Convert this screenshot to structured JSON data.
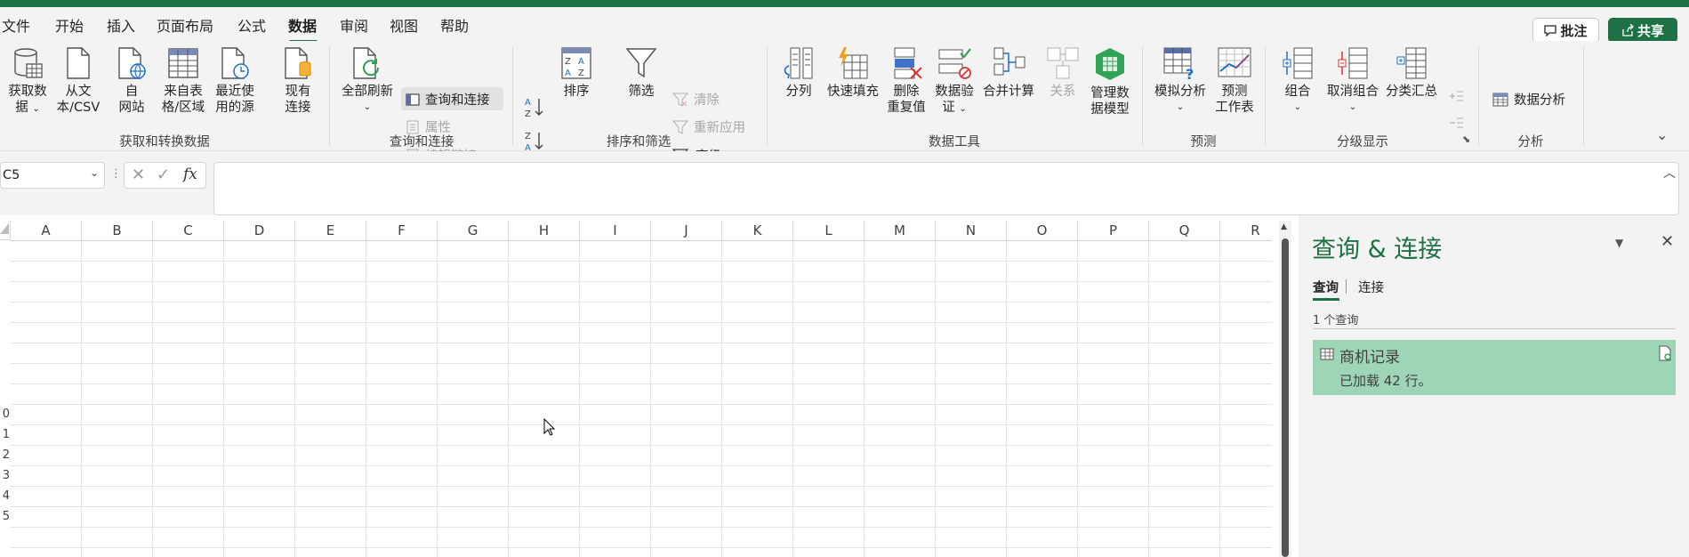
{
  "menu": {
    "items": [
      "文件",
      "开始",
      "插入",
      "页面布局",
      "公式",
      "数据",
      "审阅",
      "视图",
      "帮助"
    ],
    "active": "数据",
    "comment_label": "批注",
    "share_label": "共享"
  },
  "ribbon": {
    "get_data": {
      "line1": "获取数",
      "line2": "据"
    },
    "from_text": {
      "line1": "从文",
      "line2": "本/CSV"
    },
    "from_web": {
      "line1": "自",
      "line2": "网站"
    },
    "from_table": {
      "line1": "来自表",
      "line2": "格/区域"
    },
    "recent_sources": {
      "line1": "最近使",
      "line2": "用的源"
    },
    "existing_conn": {
      "line1": "现有",
      "line2": "连接"
    },
    "refresh_all": {
      "line1": "全部刷新"
    },
    "queries_connections": "查询和连接",
    "properties": "属性",
    "edit_links": "编辑链接",
    "sort": "排序",
    "filter": "筛选",
    "clear": "清除",
    "reapply": "重新应用",
    "advanced": "高级",
    "text_to_columns": "分列",
    "flash_fill": "快速填充",
    "remove_duplicates": {
      "line1": "删除",
      "line2": "重复值"
    },
    "data_validation": {
      "line1": "数据验",
      "line2": "证"
    },
    "consolidate": "合并计算",
    "relationships": "关系",
    "manage_model": {
      "line1": "管理数",
      "line2": "据模型"
    },
    "what_if": {
      "line1": "模拟分析"
    },
    "forecast_sheet": {
      "line1": "预测",
      "line2": "工作表"
    },
    "group": {
      "line1": "组合"
    },
    "ungroup": {
      "line1": "取消组合"
    },
    "subtotal": "分类汇总",
    "data_analysis": "数据分析",
    "groups": {
      "get_transform": "获取和转换数据",
      "queries_connections": "查询和连接",
      "sort_filter": "排序和筛选",
      "data_tools": "数据工具",
      "forecast": "预测",
      "outline": "分级显示",
      "analysis": "分析"
    }
  },
  "formula_bar": {
    "name_box": "C5",
    "fx": "fx",
    "value": ""
  },
  "grid": {
    "columns": [
      "A",
      "B",
      "C",
      "D",
      "E",
      "F",
      "G",
      "H",
      "I",
      "J",
      "K",
      "L",
      "M",
      "N",
      "O",
      "P",
      "Q",
      "R"
    ],
    "row_numbers_visible": [
      "0",
      "1",
      "2",
      "3",
      "4",
      "5"
    ]
  },
  "pane": {
    "title": "查询 & 连接",
    "tab_queries": "查询",
    "tab_connections": "连接",
    "count_text": "1 个查询",
    "query_name": "商机记录",
    "query_status": "已加载 42 行。"
  },
  "colors": {
    "accent": "#1e7145",
    "selected_query": "#9fd5b7",
    "ribbon_bg": "#f3f3f3"
  }
}
